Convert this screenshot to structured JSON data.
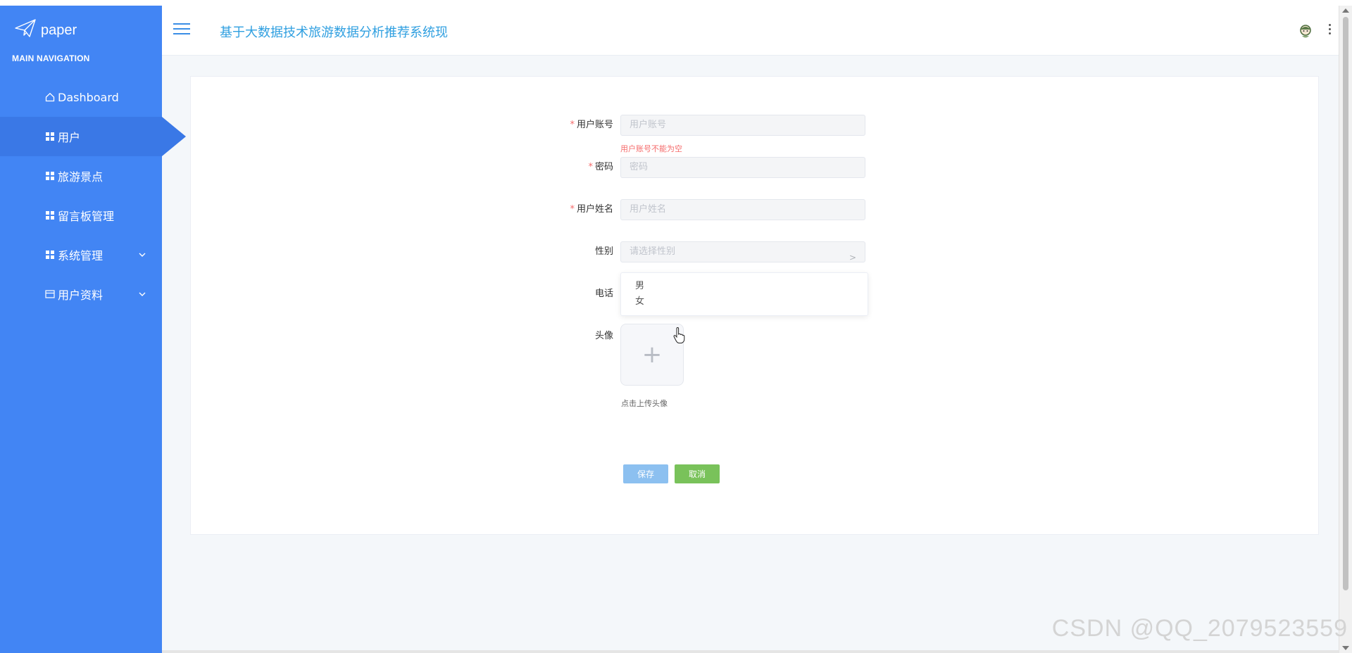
{
  "sidebar": {
    "brand": "paper",
    "nav_title": "MAIN NAVIGATION",
    "items": [
      {
        "label": "Dashboard",
        "icon": "home-icon"
      },
      {
        "label": "用户",
        "icon": "grid-icon",
        "active": true
      },
      {
        "label": "旅游景点",
        "icon": "grid-icon"
      },
      {
        "label": "留言板管理",
        "icon": "grid-icon"
      },
      {
        "label": "系统管理",
        "icon": "grid-icon",
        "has_submenu": true
      },
      {
        "label": "用户资料",
        "icon": "card-icon",
        "has_submenu": true
      }
    ]
  },
  "header": {
    "title": "基于大数据技术旅游数据分析推荐系统现"
  },
  "form": {
    "account": {
      "label": "用户账号",
      "placeholder": "用户账号",
      "required": true,
      "error": "用户账号不能为空"
    },
    "password": {
      "label": "密码",
      "placeholder": "密码",
      "required": true
    },
    "name": {
      "label": "用户姓名",
      "placeholder": "用户姓名",
      "required": true
    },
    "gender": {
      "label": "性别",
      "placeholder": "请选择性别",
      "options": [
        "男",
        "女"
      ]
    },
    "phone": {
      "label": "电话"
    },
    "avatar": {
      "label": "头像",
      "upload_symbol": "+",
      "hint": "点击上传头像"
    },
    "save_label": "保存",
    "cancel_label": "取消"
  },
  "watermark": "CSDN @QQ_2079523559",
  "colors": {
    "sidebar": "#4285f4",
    "title": "#2f9fe0",
    "error": "#f56c6c",
    "save": "#8cc0f0",
    "cancel": "#79c25a"
  }
}
